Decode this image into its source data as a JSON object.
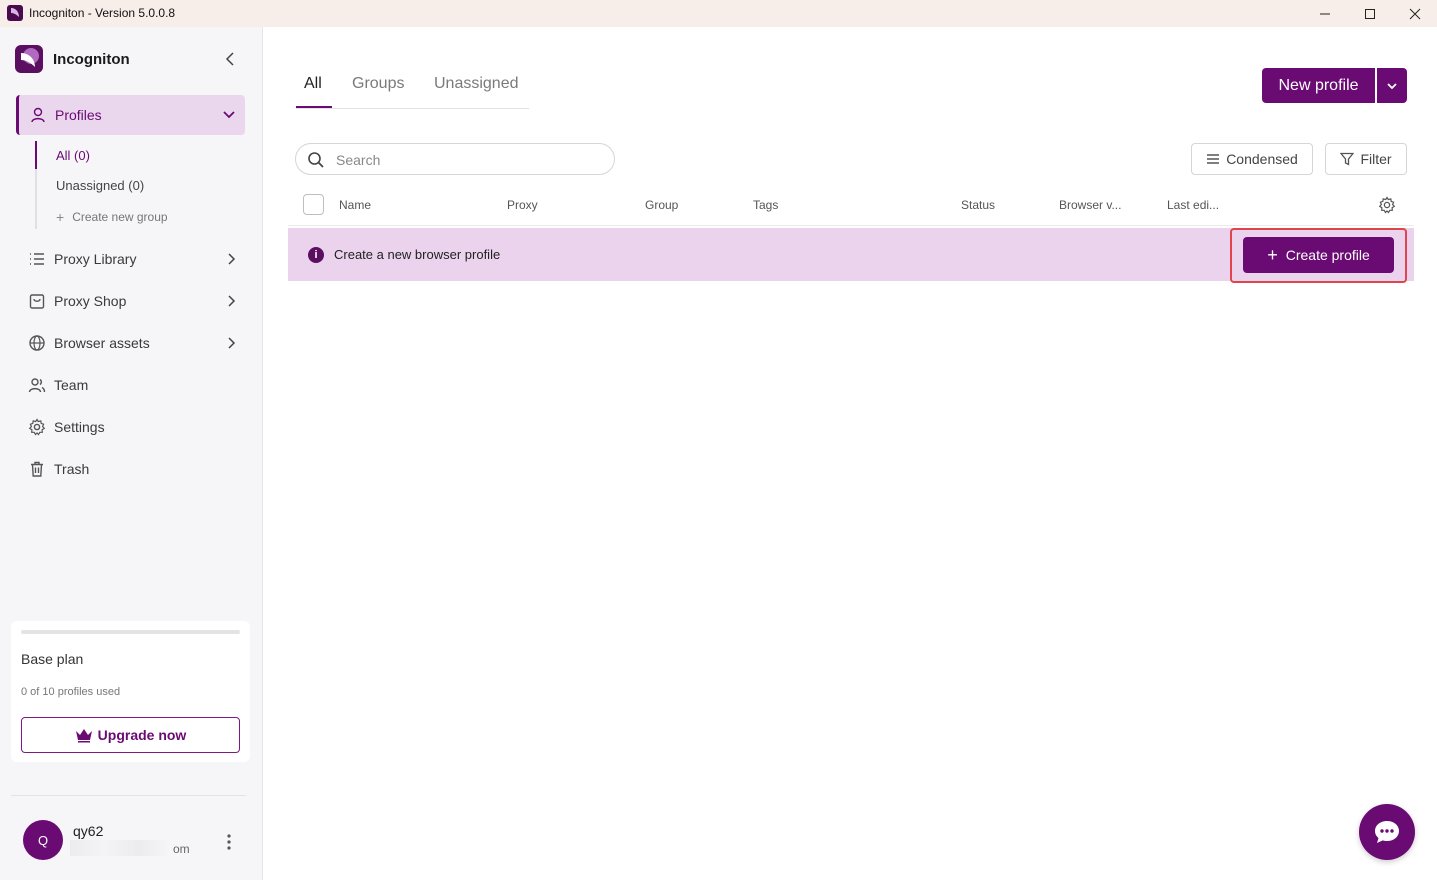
{
  "window": {
    "title": "Incogniton - Version 5.0.0.8"
  },
  "sidebar": {
    "brand": "Incogniton",
    "profiles_label": "Profiles",
    "sub_items": [
      {
        "label": "All (0)"
      },
      {
        "label": "Unassigned (0)"
      }
    ],
    "create_group": "Create new group",
    "items": [
      {
        "label": "Proxy Library",
        "icon": "list-icon"
      },
      {
        "label": "Proxy Shop",
        "icon": "shopping-bag-icon"
      },
      {
        "label": "Browser assets",
        "icon": "globe-icon"
      },
      {
        "label": "Team",
        "icon": "users-icon"
      },
      {
        "label": "Settings",
        "icon": "gear-icon"
      },
      {
        "label": "Trash",
        "icon": "trash-icon"
      }
    ],
    "plan": {
      "name": "Base plan",
      "usage": "0 of 10 profiles used",
      "upgrade_label": "Upgrade now",
      "usage_fraction": 0
    },
    "user": {
      "initial": "Q",
      "name": "qy62",
      "email_tail": "om"
    }
  },
  "main": {
    "tabs": [
      {
        "label": "All",
        "active": true
      },
      {
        "label": "Groups",
        "active": false
      },
      {
        "label": "Unassigned",
        "active": false
      }
    ],
    "new_profile_label": "New profile",
    "search_placeholder": "Search",
    "condensed_label": "Condensed",
    "filter_label": "Filter",
    "columns": [
      "Name",
      "Proxy",
      "Group",
      "Tags",
      "Status",
      "Browser v...",
      "Last edi..."
    ],
    "banner_message": "Create a new browser profile",
    "create_profile_label": "Create profile"
  },
  "colors": {
    "accent": "#6a0a73",
    "banner": "#ebd3ee",
    "highlight": "#e0454d",
    "titlebar": "#f7ede9"
  }
}
